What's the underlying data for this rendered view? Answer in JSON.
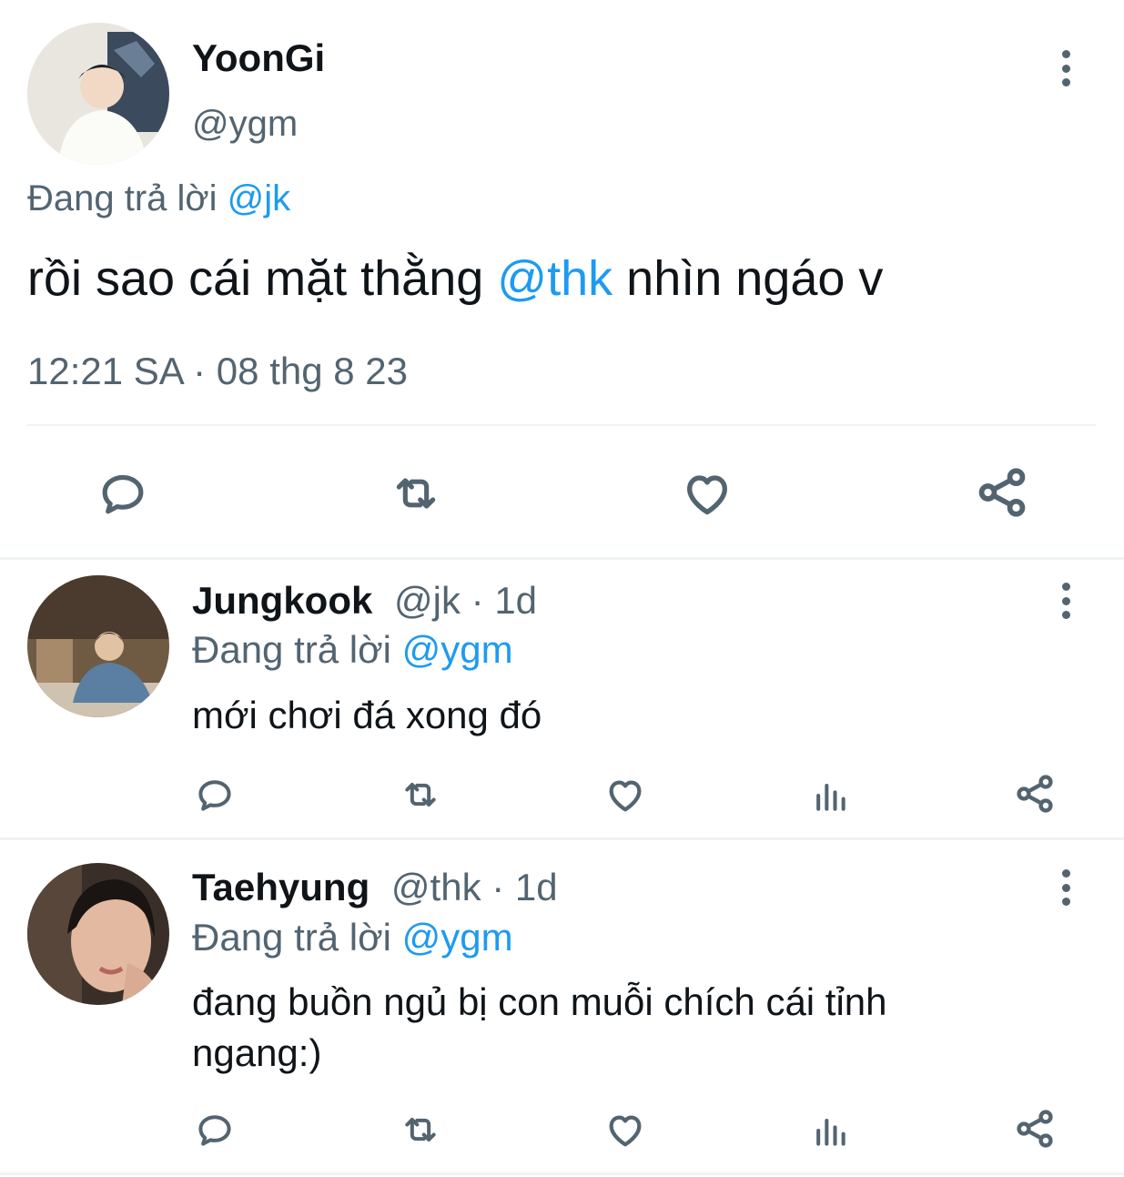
{
  "main_tweet": {
    "name": "YoonGi",
    "handle": "@ygm",
    "replying_prefix": "Đang trả lời",
    "replying_to": "@jk",
    "text_before": "rồi sao cái mặt thằng",
    "mention": "@thk",
    "text_after": "nhìn ngáo v",
    "timestamp": "12:21 SA · 08 thg 8 23"
  },
  "replies": [
    {
      "name": "Jungkook",
      "handle": "@jk",
      "age": "· 1d",
      "replying_prefix": "Đang trả lời",
      "replying_to": "@ygm",
      "text_line1": "mới chơi đá xong đó",
      "text_line2": ""
    },
    {
      "name": "Taehyung",
      "handle": "@thk",
      "age": "· 1d",
      "replying_prefix": "Đang trả lời",
      "replying_to": "@ygm",
      "text_line1": "đang buồn ngủ bị con muỗi chích cái tỉnh",
      "text_line2": "ngang:)"
    }
  ],
  "icons": [
    "reply-icon",
    "retweet-icon",
    "like-icon",
    "analytics-icon",
    "share-icon",
    "more-options-icon"
  ],
  "colors": {
    "accent": "#1d9bf0",
    "secondary_text": "#536471",
    "divider": "#eff3f4"
  }
}
